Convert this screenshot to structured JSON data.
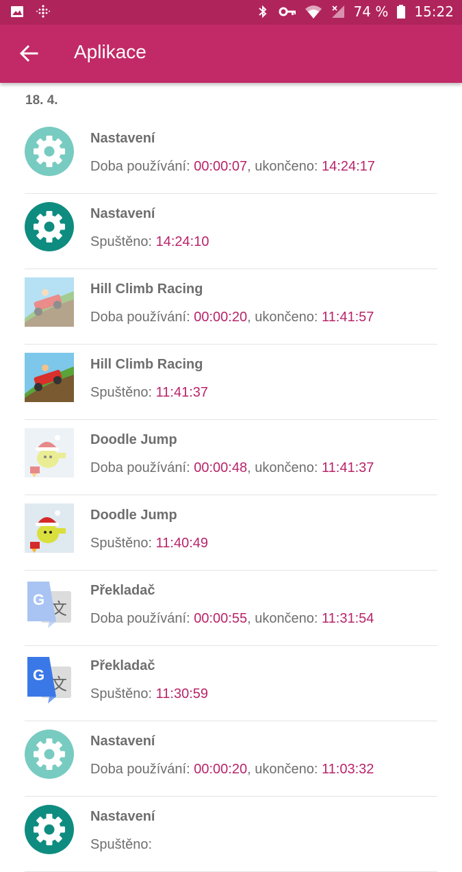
{
  "status_bar": {
    "battery": "74 %",
    "time": "15:22"
  },
  "appbar": {
    "title": "Aplikace"
  },
  "date_header": "18. 4.",
  "labels": {
    "usage": "Doba používání: ",
    "ended": ", ukončeno: ",
    "started": "Spuštěno: "
  },
  "rows": [
    {
      "app": "Nastavení",
      "icon": "settings-gear-icon",
      "type": "usage",
      "duration": "00:00:07",
      "time": "14:24:17"
    },
    {
      "app": "Nastavení",
      "icon": "settings-gear-icon",
      "type": "start",
      "time": "14:24:10"
    },
    {
      "app": "Hill Climb Racing",
      "icon": "hill-climb-racing-icon",
      "type": "usage",
      "duration": "00:00:20",
      "time": "11:41:57"
    },
    {
      "app": "Hill Climb Racing",
      "icon": "hill-climb-racing-icon",
      "type": "start",
      "time": "11:41:37"
    },
    {
      "app": "Doodle Jump",
      "icon": "doodle-jump-icon",
      "type": "usage",
      "duration": "00:00:48",
      "time": "11:41:37"
    },
    {
      "app": "Doodle Jump",
      "icon": "doodle-jump-icon",
      "type": "start",
      "time": "11:40:49"
    },
    {
      "app": "Překladač",
      "icon": "google-translate-icon",
      "type": "usage",
      "duration": "00:00:55",
      "time": "11:31:54"
    },
    {
      "app": "Překladač",
      "icon": "google-translate-icon",
      "type": "start",
      "time": "11:30:59"
    },
    {
      "app": "Nastavení",
      "icon": "settings-gear-icon",
      "type": "usage",
      "duration": "00:00:20",
      "time": "11:03:32"
    },
    {
      "app": "Nastavení",
      "icon": "settings-gear-icon",
      "type": "start",
      "time": ""
    }
  ],
  "colors": {
    "status_bar": "#b0245c",
    "app_bar": "#c22a67",
    "accent_text": "#b8236a",
    "gear_light": "#78cbc1",
    "gear_dark": "#0f8c80"
  }
}
